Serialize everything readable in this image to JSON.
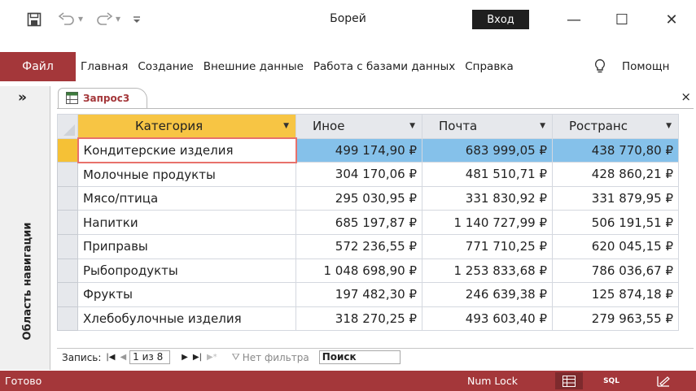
{
  "app": {
    "title": "Борей",
    "sign_in": "Вход"
  },
  "quick_access": {
    "save_icon": "save-icon",
    "undo_icon": "undo-icon",
    "redo_icon": "redo-icon",
    "customize_glyph": "▾"
  },
  "window_controls": {
    "minimize": "—",
    "maximize": "☐",
    "close": "✕"
  },
  "ribbon": {
    "file": "Файл",
    "tabs": [
      "Главная",
      "Создание",
      "Внешние данные",
      "Работа с базами данных",
      "Справка"
    ],
    "tell_me": "Помощн"
  },
  "nav_pane": {
    "toggle": "»",
    "label": "Область навигации"
  },
  "document": {
    "tab_label": "Запрос3",
    "close": "×"
  },
  "datasheet": {
    "columns": [
      "Категория",
      "Иное",
      "Почта",
      "Ространс"
    ],
    "rows": [
      [
        "Кондитерские изделия",
        "499 174,90 ₽",
        "683 999,05 ₽",
        "438 770,80 ₽"
      ],
      [
        "Молочные продукты",
        "304 170,06 ₽",
        "481 510,71 ₽",
        "428 860,21 ₽"
      ],
      [
        "Мясо/птица",
        "295 030,95 ₽",
        "331 830,92 ₽",
        "331 879,95 ₽"
      ],
      [
        "Напитки",
        "685 197,87 ₽",
        "1 140 727,99 ₽",
        "506 191,51 ₽"
      ],
      [
        "Приправы",
        "572 236,55 ₽",
        "771 710,25 ₽",
        "620 045,15 ₽"
      ],
      [
        "Рыбопродукты",
        "1 048 698,90 ₽",
        "1 253 833,68 ₽",
        "786 036,67 ₽"
      ],
      [
        "Фрукты",
        "197 482,30 ₽",
        "246 639,38 ₽",
        "125 874,18 ₽"
      ],
      [
        "Хлебобулочные изделия",
        "318 270,25 ₽",
        "493 603,40 ₽",
        "279 963,55 ₽"
      ]
    ]
  },
  "record_nav": {
    "label": "Запись:",
    "position": "1 из 8",
    "filter": "Нет фильтра",
    "search": "Поиск"
  },
  "status": {
    "ready": "Готово",
    "num_lock": "Num Lock",
    "sql": "SQL"
  },
  "colors": {
    "accent": "#a4373a",
    "header_highlight": "#f7c544",
    "selection": "#85c1ea"
  }
}
